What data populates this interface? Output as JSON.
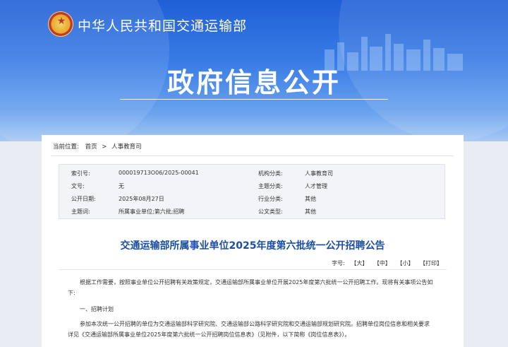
{
  "header": {
    "ministry_name": "中华人民共和国交通运输部",
    "page_title": "政府信息公开",
    "emblem_icon": "national-emblem-icon"
  },
  "breadcrumb": {
    "prefix": "当前位置:",
    "items": [
      "首页",
      "人事教育司"
    ],
    "separator": ">"
  },
  "meta": {
    "rows": [
      {
        "label1": "索引号:",
        "value1": "000019713O06/2025-00041",
        "label2": "机构分类:",
        "value2": "人事教育司"
      },
      {
        "label1": "文号:",
        "value1": "无",
        "label2": "主题分类:",
        "value2": "人才管理"
      },
      {
        "label1": "公开日期:",
        "value1": "2025年08月27日",
        "label2": "行业分类:",
        "value2": "其他"
      },
      {
        "label1": "主题词:",
        "value1": "所属事业单位;第六批;招聘",
        "label2": "公文类型:",
        "value2": "其他"
      }
    ]
  },
  "article": {
    "title": "交通运输部所属事业单位2025年度第六批统一公开招聘公告",
    "font_size_label": "字号:",
    "font_buttons": [
      "【大】",
      "【中】",
      "【小】",
      "【打印】"
    ],
    "paragraphs": [
      "根据工作需要，按照事业单位公开招聘有关政策规定，交通运输部所属事业单位开展2025年度第六批统一公开招聘工作。现将有关事项公告如",
      "下:",
      "一、招聘计划",
      "参加本次统一公开招聘的单位为交通运输部科学研究院、交通运输部公路科学研究院和交通运输部规划研究院。招聘单位岗位信息和相关要求",
      "详见《交通运输部所属事业单位2025年度第六批统一公开招聘岗位信息表》（见附件，以下简称《岗位信息表》）。"
    ]
  },
  "colors": {
    "banner_top": "#1f5fd6",
    "title_blue": "#1a4fa3"
  }
}
